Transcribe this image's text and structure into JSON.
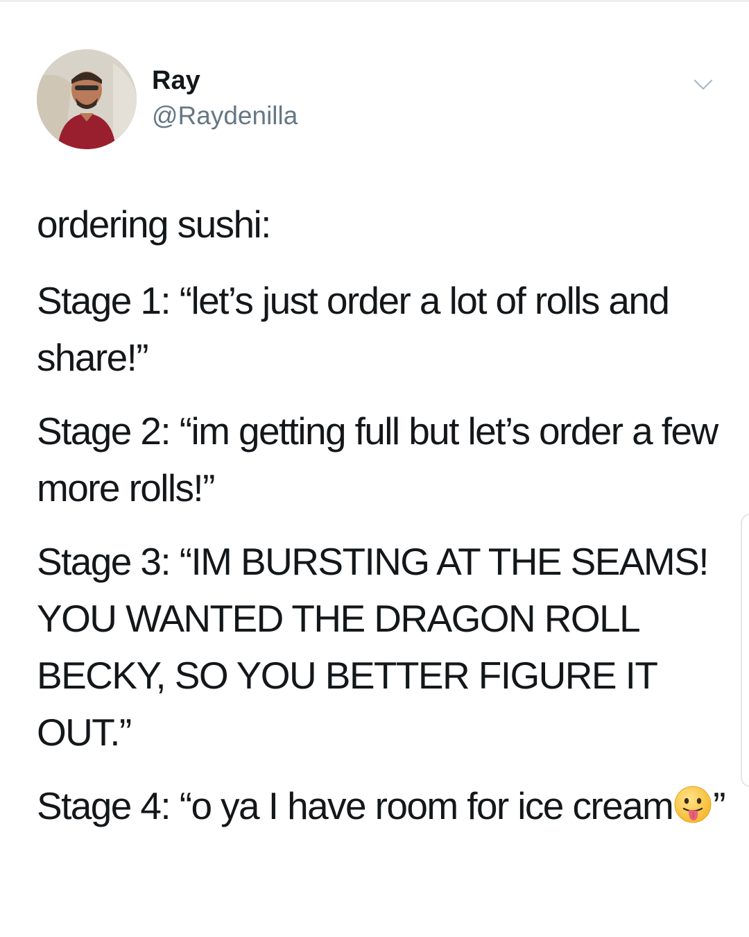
{
  "tweet": {
    "author_name": "Ray",
    "author_handle": "@Raydenilla",
    "avatar_icon": "profile-photo",
    "menu_icon": "chevron-down-icon",
    "paragraphs": [
      "ordering sushi:",
      "Stage 1: “let’s just order a lot of rolls and share!”",
      "Stage 2: “im getting full but let’s order a few more rolls!”",
      "Stage 3: “IM BURSTING AT THE SEAMS! YOU WANTED THE DRAGON ROLL BECKY, SO YOU BETTER FIGURE IT OUT.”"
    ],
    "last_paragraph_text": "Stage 4: “o ya I have room for ice cream",
    "last_paragraph_suffix": "”",
    "emoji_icon": "tongue-out-face-emoji"
  },
  "colors": {
    "text": "#14171a",
    "handle": "#657786",
    "background": "#ffffff"
  }
}
